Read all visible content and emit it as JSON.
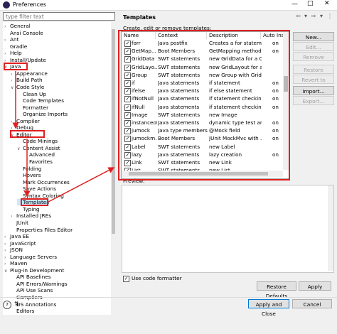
{
  "window": {
    "title": "Preferences"
  },
  "filter": {
    "placeholder": "type filter text"
  },
  "tree": [
    {
      "label": "General",
      "indent": 0,
      "twisty": ">"
    },
    {
      "label": "Ansi Console",
      "indent": 0,
      "twisty": ""
    },
    {
      "label": "Ant",
      "indent": 0,
      "twisty": ">"
    },
    {
      "label": "Gradle",
      "indent": 0,
      "twisty": ""
    },
    {
      "label": "Help",
      "indent": 0,
      "twisty": ">"
    },
    {
      "label": "Install/Update",
      "indent": 0,
      "twisty": ">"
    },
    {
      "label": "Java",
      "indent": 0,
      "twisty": "v"
    },
    {
      "label": "Appearance",
      "indent": 1,
      "twisty": ">"
    },
    {
      "label": "Build Path",
      "indent": 1,
      "twisty": ">"
    },
    {
      "label": "Code Style",
      "indent": 1,
      "twisty": "v"
    },
    {
      "label": "Clean Up",
      "indent": 2,
      "twisty": ""
    },
    {
      "label": "Code Templates",
      "indent": 2,
      "twisty": ""
    },
    {
      "label": "Formatter",
      "indent": 2,
      "twisty": ""
    },
    {
      "label": "Organize Imports",
      "indent": 2,
      "twisty": ""
    },
    {
      "label": "Compiler",
      "indent": 1,
      "twisty": ">"
    },
    {
      "label": "Debug",
      "indent": 1,
      "twisty": ">"
    },
    {
      "label": "Editor",
      "indent": 1,
      "twisty": "v"
    },
    {
      "label": "Code Minings",
      "indent": 2,
      "twisty": ""
    },
    {
      "label": "Content Assist",
      "indent": 2,
      "twisty": "v"
    },
    {
      "label": "Advanced",
      "indent": 3,
      "twisty": ""
    },
    {
      "label": "Favorites",
      "indent": 3,
      "twisty": ""
    },
    {
      "label": "Folding",
      "indent": 2,
      "twisty": ""
    },
    {
      "label": "Hovers",
      "indent": 2,
      "twisty": ""
    },
    {
      "label": "Mark Occurrences",
      "indent": 2,
      "twisty": ""
    },
    {
      "label": "Save Actions",
      "indent": 2,
      "twisty": ""
    },
    {
      "label": "Syntax Coloring",
      "indent": 2,
      "twisty": ""
    },
    {
      "label": "Templates",
      "indent": 2,
      "twisty": ""
    },
    {
      "label": "Typing",
      "indent": 2,
      "twisty": ""
    },
    {
      "label": "Installed JREs",
      "indent": 1,
      "twisty": ">"
    },
    {
      "label": "JUnit",
      "indent": 1,
      "twisty": ""
    },
    {
      "label": "Properties Files Editor",
      "indent": 1,
      "twisty": ""
    },
    {
      "label": "Java EE",
      "indent": 0,
      "twisty": ">"
    },
    {
      "label": "JavaScript",
      "indent": 0,
      "twisty": ">"
    },
    {
      "label": "JSON",
      "indent": 0,
      "twisty": ">"
    },
    {
      "label": "Language Servers",
      "indent": 0,
      "twisty": ">"
    },
    {
      "label": "Maven",
      "indent": 0,
      "twisty": ">"
    },
    {
      "label": "Plug-in Development",
      "indent": 0,
      "twisty": "v"
    },
    {
      "label": "API Baselines",
      "indent": 1,
      "twisty": ""
    },
    {
      "label": "API Errors/Warnings",
      "indent": 1,
      "twisty": ""
    },
    {
      "label": "API Use Scans",
      "indent": 1,
      "twisty": ""
    },
    {
      "label": "Compilers",
      "indent": 1,
      "twisty": ""
    },
    {
      "label": "DS Annotations",
      "indent": 1,
      "twisty": ""
    },
    {
      "label": "Editors",
      "indent": 1,
      "twisty": ""
    }
  ],
  "page": {
    "title": "Templates",
    "description": "Create, edit or remove templates:",
    "columns": [
      "Name",
      "Context",
      "Description",
      "Auto Inse"
    ],
    "rows": [
      [
        "forr",
        "Java postfix",
        "Creates a for stateme...",
        "on"
      ],
      [
        "GetMap...",
        "Boot Members",
        "GetMapping method",
        "on"
      ],
      [
        "GridData",
        "SWT statements",
        "new GridData for a C...",
        ""
      ],
      [
        "GridLayo...",
        "SWT statements",
        "new GridLayout for a ...",
        ""
      ],
      [
        "Group",
        "SWT statements",
        "new Group with GridL...",
        ""
      ],
      [
        "if",
        "Java statements",
        "if statement",
        "on"
      ],
      [
        "ifelse",
        "Java statements",
        "if else statement",
        "on"
      ],
      [
        "ifNotNull",
        "Java statements",
        "if statement checking...",
        "on"
      ],
      [
        "ifNull",
        "Java statements",
        "if statement checking...",
        "on"
      ],
      [
        "Image",
        "SWT statements",
        "new Image",
        ""
      ],
      [
        "instanceof",
        "Java statements",
        "dynamic type test an...",
        "on"
      ],
      [
        "jumock",
        "Java type members",
        "@Mock field",
        "on"
      ],
      [
        "jumockm...",
        "Boot Members",
        "JUnit MockMvc with ...",
        "on"
      ],
      [
        "Label",
        "SWT statements",
        "new Label",
        ""
      ],
      [
        "lazy",
        "Java statements",
        "lazy creation",
        "on"
      ],
      [
        "Link",
        "SWT statements",
        "new Link",
        ""
      ],
      [
        "List",
        "SWT statements",
        "new List",
        ""
      ]
    ],
    "buttons": {
      "new": "New...",
      "edit": "Edit...",
      "remove": "Remove",
      "restore_removed": "Restore Removed",
      "revert_default": "Revert to Default",
      "import": "Import...",
      "export": "Export..."
    },
    "preview_label": "Preview:",
    "use_formatter": "Use code formatter",
    "restore_defaults": "Restore Defaults",
    "apply": "Apply"
  },
  "footer": {
    "apply_close": "Apply and Close",
    "cancel": "Cancel"
  }
}
